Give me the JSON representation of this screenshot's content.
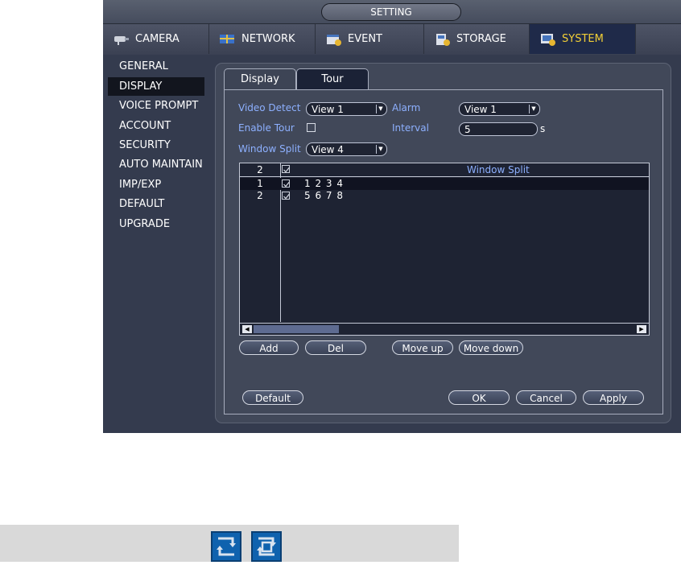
{
  "window": {
    "title": "SETTING"
  },
  "main_tabs": [
    {
      "label": "CAMERA",
      "icon": "camera-icon",
      "active": false
    },
    {
      "label": "NETWORK",
      "icon": "network-icon",
      "active": false
    },
    {
      "label": "EVENT",
      "icon": "event-icon",
      "active": false
    },
    {
      "label": "STORAGE",
      "icon": "storage-icon",
      "active": false
    },
    {
      "label": "SYSTEM",
      "icon": "system-icon",
      "active": true
    }
  ],
  "sidebar": {
    "items": [
      {
        "label": "GENERAL",
        "active": false
      },
      {
        "label": "DISPLAY",
        "active": true
      },
      {
        "label": "VOICE PROMPT",
        "active": false
      },
      {
        "label": "ACCOUNT",
        "active": false
      },
      {
        "label": "SECURITY",
        "active": false
      },
      {
        "label": "AUTO MAINTAIN",
        "active": false
      },
      {
        "label": "IMP/EXP",
        "active": false
      },
      {
        "label": "DEFAULT",
        "active": false
      },
      {
        "label": "UPGRADE",
        "active": false
      }
    ]
  },
  "sub_tabs": [
    {
      "label": "Display",
      "active": false
    },
    {
      "label": "Tour",
      "active": true
    }
  ],
  "form": {
    "video_detect_label": "Video Detect",
    "video_detect_value": "View 1",
    "alarm_label": "Alarm",
    "alarm_value": "View 1",
    "enable_tour_label": "Enable Tour",
    "interval_label": "Interval",
    "interval_value": "5",
    "interval_unit": "s",
    "window_split_label": "Window Split",
    "window_split_value": "View 4"
  },
  "table": {
    "header_count": "2",
    "header_title": "Window Split",
    "rows": [
      {
        "num": "1",
        "checked": true,
        "split": "1  2  3  4",
        "selected": true
      },
      {
        "num": "2",
        "checked": true,
        "split": "5  6  7  8",
        "selected": false
      }
    ]
  },
  "buttons": {
    "add": "Add",
    "del": "Del",
    "move_up": "Move up",
    "move_down": "Move down",
    "default": "Default",
    "ok": "OK",
    "cancel": "Cancel",
    "apply": "Apply"
  },
  "colors": {
    "accent_active_tab": "#f2cf36",
    "label_blue": "#8db0ff",
    "panel_bg": "#414859",
    "window_bg": "#343b4e"
  },
  "footer": {
    "icons": [
      "tour-square-icon",
      "tour-window-icon"
    ]
  }
}
